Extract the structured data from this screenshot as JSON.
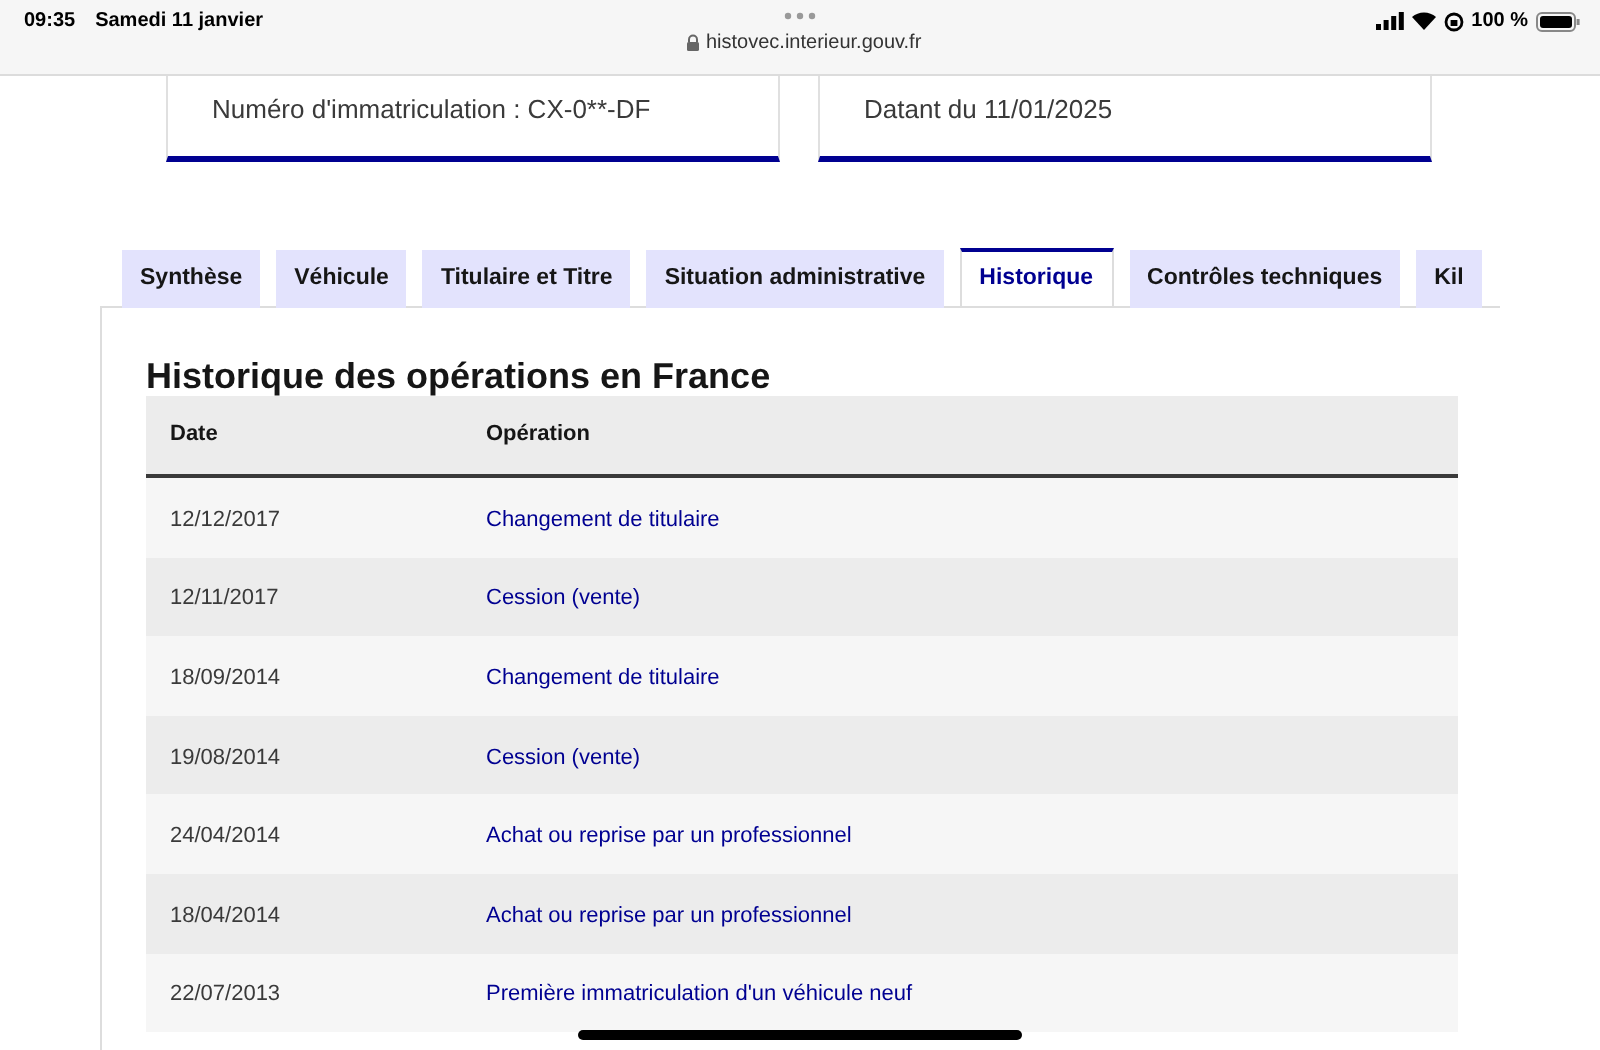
{
  "status_bar": {
    "time": "09:35",
    "date": "Samedi 11 janvier",
    "url": "histovec.interieur.gouv.fr",
    "battery": "100 %"
  },
  "cards": [
    {
      "text": "Numéro d'immatriculation : CX-0**-DF"
    },
    {
      "text": "Datant du 11/01/2025"
    }
  ],
  "tabs": [
    {
      "label": "Synthèse",
      "selected": false
    },
    {
      "label": "Véhicule",
      "selected": false
    },
    {
      "label": "Titulaire et Titre",
      "selected": false
    },
    {
      "label": "Situation administrative",
      "selected": false
    },
    {
      "label": "Historique",
      "selected": true
    },
    {
      "label": "Contrôles techniques",
      "selected": false
    },
    {
      "label": "Kil",
      "selected": false
    }
  ],
  "section_title": "Historique des opérations en France",
  "table": {
    "columns": [
      "Date",
      "Opération"
    ],
    "rows": [
      [
        "12/12/2017",
        "Changement de titulaire"
      ],
      [
        "12/11/2017",
        "Cession (vente)"
      ],
      [
        "18/09/2014",
        "Changement de titulaire"
      ],
      [
        "19/08/2014",
        "Cession (vente)"
      ],
      [
        "24/04/2014",
        "Achat ou reprise par un professionnel"
      ],
      [
        "18/04/2014",
        "Achat ou reprise par un professionnel"
      ],
      [
        "22/07/2013",
        "Première immatriculation d'un véhicule neuf"
      ]
    ]
  }
}
